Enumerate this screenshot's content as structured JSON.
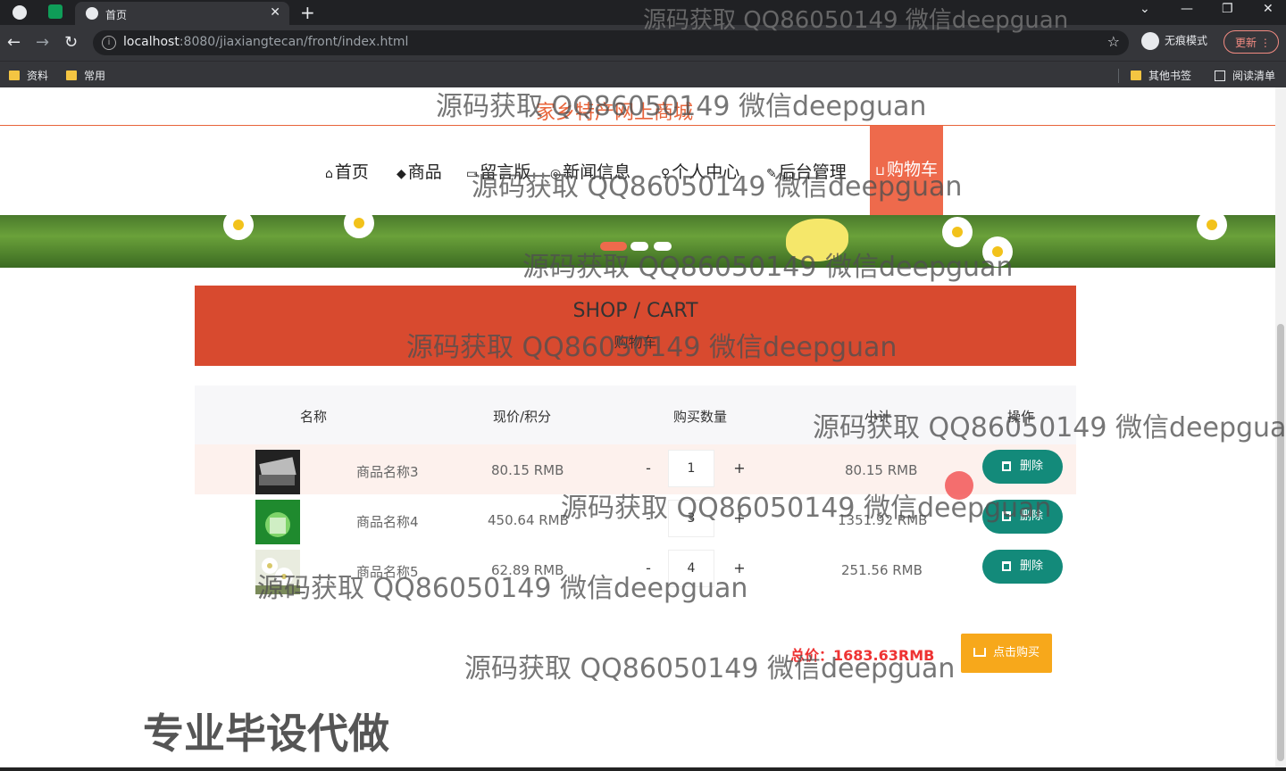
{
  "browser": {
    "tab_title": "首页",
    "url_host": "localhost",
    "url_path": ":8080/jiaxiangtecan/front/index.html",
    "incognito_label": "无痕模式",
    "update_label": "更新",
    "bookmarks_left": [
      "资料",
      "常用"
    ],
    "bookmarks_right": [
      "其他书签",
      "阅读清单"
    ]
  },
  "site": {
    "title": "家乡特产网上商城",
    "nav": [
      {
        "icon": "⌂",
        "label": "首页"
      },
      {
        "icon": "◆",
        "label": "商品"
      },
      {
        "icon": "▭",
        "label": "留言版"
      },
      {
        "icon": "◎",
        "label": "新闻信息"
      },
      {
        "icon": "♀",
        "label": "个人中心"
      },
      {
        "icon": "✎",
        "label": "后台管理"
      },
      {
        "icon": "⊔",
        "label": "购物车"
      }
    ]
  },
  "cart": {
    "heading_en": "SHOP / CART",
    "heading_cn": "购物车",
    "columns": [
      "名称",
      "现价/积分",
      "购买数量",
      "小计",
      "操作"
    ],
    "items": [
      {
        "name": "商品名称3",
        "price": "80.15 RMB",
        "qty": "1",
        "subtotal": "80.15 RMB",
        "delete": "删除"
      },
      {
        "name": "商品名称4",
        "price": "450.64 RMB",
        "qty": "3",
        "subtotal": "1351.92 RMB",
        "delete": "删除"
      },
      {
        "name": "商品名称5",
        "price": "62.89 RMB",
        "qty": "4",
        "subtotal": "251.56 RMB",
        "delete": "删除"
      }
    ],
    "qty_minus": "-",
    "qty_plus": "+",
    "total_label": "总价：",
    "total_value": "1683.63RMB",
    "buy_label": "点击购买"
  },
  "watermarks": {
    "text": "源码获取 QQ86050149 微信deepguan",
    "banner": "专业毕设代做"
  },
  "colors": {
    "accent": "#ee6a4c",
    "hero": "#d84a2f",
    "delete": "#138a7a",
    "buy": "#f7a81b"
  }
}
